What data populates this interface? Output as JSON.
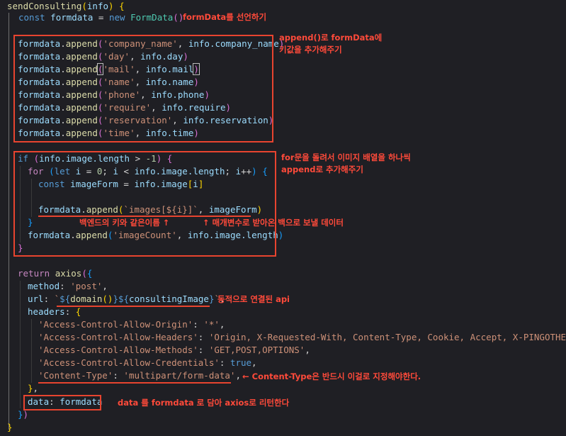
{
  "code": {
    "fn_name": "sendConsulting",
    "param": "info",
    "l2_kw": "const",
    "l2_var": "formdata",
    "l2_new": "new",
    "l2_cls": "FormData",
    "append_lines": [
      {
        "key": "'company_name'",
        "val": "info.company_name"
      },
      {
        "key": "'day'",
        "val": "info.day"
      },
      {
        "key": "'mail'",
        "val": "info.mail"
      },
      {
        "key": "'name'",
        "val": "info.name"
      },
      {
        "key": "'phone'",
        "val": "info.phone"
      },
      {
        "key": "'require'",
        "val": "info.require"
      },
      {
        "key": "'reservation'",
        "val": "info.reservation"
      },
      {
        "key": "'time'",
        "val": "info.time"
      }
    ],
    "if_kw": "if",
    "if_cond": "info.image.length",
    "if_num": "-1",
    "for_kw": "for",
    "let_kw": "let",
    "const_kw": "const",
    "image_form": "imageForm",
    "template_images": "`images[${i}]`",
    "image_count_key": "'imageCount'",
    "image_count_val": "info.image.length",
    "return_kw": "return",
    "axios": "axios",
    "method_key": "method",
    "method_val": "'post'",
    "url_key": "url",
    "domain_fn": "domain",
    "consulting_image": "consultingImage",
    "headers_key": "headers",
    "h1_key": "'Access-Control-Allow-Origin'",
    "h1_val": "'*'",
    "h2_key": "'Access-Control-Allow-Headers'",
    "h2_val": "'Origin, X-Requested-With, Content-Type, Cookie, Accept, X-PINGOTHER'",
    "h3_key": "'Access-Control-Allow-Methods'",
    "h3_val": "'GET,POST,OPTIONS'",
    "h4_key": "'Access-Control-Allow-Credentials'",
    "h4_val": "true",
    "h5_key": "'Content-Type'",
    "h5_val": "'multipart/form-data'",
    "data_key": "data",
    "data_val": "formdata"
  },
  "notes": {
    "n1": "formData를 선언하기",
    "n2a": "append()로 formData에",
    "n2b": "키값을 추가해주기",
    "n3a": "for문을 돌려서 이미지 배열을 하나씩",
    "n3b": "append로 추가해주기",
    "n4": "백엔드의 키와 같은이름 ↑",
    "n5": "↑ 매개변수로 받아온 백으로 보낼 데이터",
    "n6": "동적으로 연결된 api",
    "n7": "← Content-Type은 반드시 이걸로 지정해야한다.",
    "n8": "data 를 formdata 로 담아 axios로 리턴한다"
  },
  "colors": {
    "background": "#1f1f24",
    "annotation": "#e8442f"
  }
}
